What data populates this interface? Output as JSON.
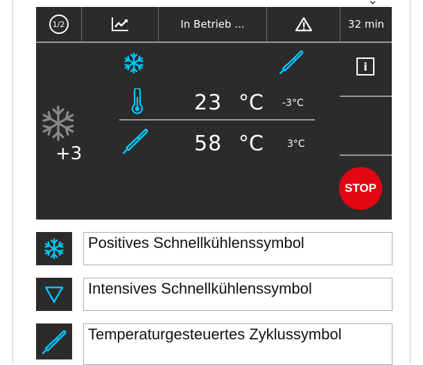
{
  "colors": {
    "screen_bg": "#2b2b2b",
    "accent_cyan": "#00c8ff",
    "stop_red": "#e30613",
    "snowflake_grey": "#8a8a8a"
  },
  "topbar": {
    "page_indicator": "1/2",
    "graph_icon": "graph-icon",
    "status": "In Betrieb ...",
    "warning_icon": "warning-icon",
    "remaining_time": "32 min"
  },
  "main": {
    "mode_icons": [
      "snowflake-icon",
      "probe-icon"
    ],
    "chamber": {
      "icon": "thermometer-icon",
      "value": "23",
      "unit": "°C",
      "setpoint": "-3°C"
    },
    "probe": {
      "icon": "probe-icon",
      "value": "58",
      "unit": "°C",
      "setpoint": "3°C"
    },
    "cycle_indicator": {
      "icon": "snowflake-icon",
      "label": "+3"
    },
    "side_panel": {
      "info_label": "i",
      "stop_label": "STOP"
    }
  },
  "legend": [
    {
      "icon": "snowflake-icon",
      "text": "Positives Schnellkühlenssymbol"
    },
    {
      "icon": "triangle-down-icon",
      "text": "Intensives Schnellkühlenssymbol"
    },
    {
      "icon": "probe-icon",
      "text": "Temperaturgesteuertes Zyklussymbol"
    }
  ]
}
